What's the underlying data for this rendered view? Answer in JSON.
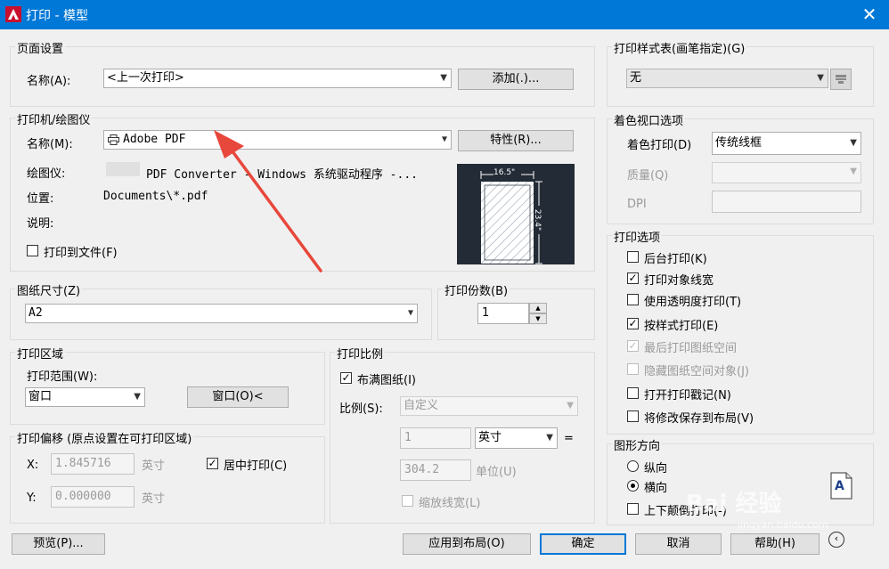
{
  "window": {
    "title": "打印 - 模型",
    "close_glyph": "✕"
  },
  "page_setup": {
    "legend": "页面设置",
    "name_label": "名称(A):",
    "name_value": "<上一次打印>",
    "add_button": "添加(.)..."
  },
  "plotter": {
    "legend": "打印机/绘图仪",
    "name_label": "名称(M):",
    "name_value": "Adobe PDF",
    "properties_button": "特性(R)...",
    "plotter_label": "绘图仪:",
    "plotter_value": "PDF Converter - Windows 系统驱动程序 -...",
    "location_label": "位置:",
    "location_value": "Documents\\*.pdf",
    "description_label": "说明:",
    "plot_to_file_label": "打印到文件(F)",
    "plot_to_file_checked": false,
    "preview": {
      "width_label": "16.5\"",
      "height_label": "23.4\""
    }
  },
  "paper_size": {
    "legend": "图纸尺寸(Z)",
    "value": "A2"
  },
  "copies": {
    "legend": "打印份数(B)",
    "value": "1"
  },
  "plot_area": {
    "legend": "打印区域",
    "range_label": "打印范围(W):",
    "range_value": "窗口",
    "window_button": "窗口(O)<"
  },
  "plot_offset": {
    "legend": "打印偏移 (原点设置在可打印区域)",
    "x_label": "X:",
    "x_value": "1.845716",
    "x_unit": "英寸",
    "y_label": "Y:",
    "y_value": "0.000000",
    "y_unit": "英寸",
    "center_label": "居中打印(C)",
    "center_checked": true
  },
  "plot_scale": {
    "legend": "打印比例",
    "fit_label": "布满图纸(I)",
    "fit_checked": true,
    "scale_label": "比例(S):",
    "scale_value": "自定义",
    "value1": "1",
    "unit_value": "英寸",
    "equals": "=",
    "value2": "304.2",
    "unit2_label": "单位(U)",
    "lineweights_label": "缩放线宽(L)"
  },
  "plot_style": {
    "legend": "打印样式表(画笔指定)(G)",
    "value": "无"
  },
  "shaded_viewport": {
    "legend": "着色视口选项",
    "shade_label": "着色打印(D)",
    "shade_value": "传统线框",
    "quality_label": "质量(Q)",
    "dpi_label": "DPI"
  },
  "plot_options": {
    "legend": "打印选项",
    "items": [
      {
        "label": "后台打印(K)",
        "checked": false,
        "enabled": true
      },
      {
        "label": "打印对象线宽",
        "checked": true,
        "enabled": true
      },
      {
        "label": "使用透明度打印(T)",
        "checked": false,
        "enabled": true
      },
      {
        "label": "按样式打印(E)",
        "checked": true,
        "enabled": true
      },
      {
        "label": "最后打印图纸空间",
        "checked": true,
        "enabled": false
      },
      {
        "label": "隐藏图纸空间对象(J)",
        "checked": false,
        "enabled": false
      },
      {
        "label": "打开打印戳记(N)",
        "checked": false,
        "enabled": true
      },
      {
        "label": "将修改保存到布局(V)",
        "checked": false,
        "enabled": true
      }
    ]
  },
  "orientation": {
    "legend": "图形方向",
    "portrait_label": "纵向",
    "landscape_label": "横向",
    "upside_down_label": "上下颠倒打印(-)",
    "selected": "landscape",
    "icon_letter": "A"
  },
  "footer": {
    "preview_button": "预览(P)...",
    "apply_button": "应用到布局(O)",
    "ok_button": "确定",
    "cancel_button": "取消",
    "help_button": "帮助(H)"
  },
  "watermark": {
    "text": "Bai 经验",
    "url": "jingyan.baidu.com"
  },
  "colors": {
    "titlebar": "#0078d7",
    "annotation_arrow": "#e8473b"
  }
}
